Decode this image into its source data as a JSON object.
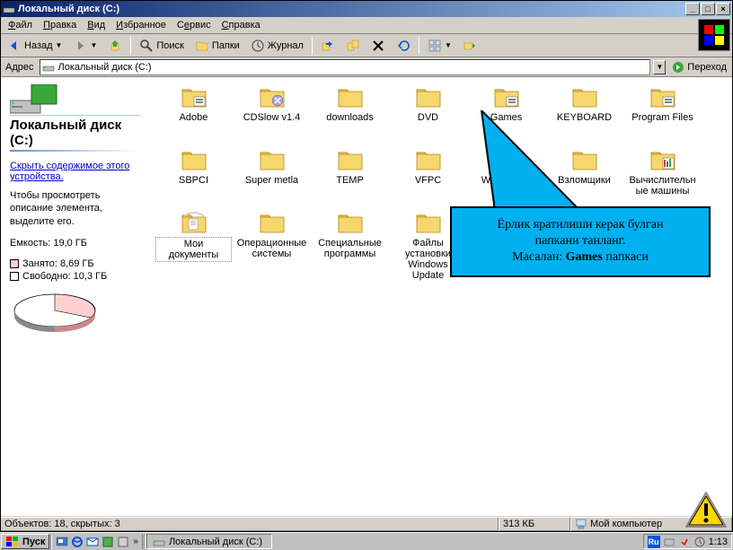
{
  "window": {
    "title": "Локальный диск (C:)",
    "min": "_",
    "max": "□",
    "close": "×"
  },
  "menu": {
    "file": "Файл",
    "edit": "Правка",
    "view": "Вид",
    "favorites": "Избранное",
    "tools": "Сервис",
    "help": "Справка"
  },
  "toolbar": {
    "back": "Назад",
    "search": "Поиск",
    "folders": "Папки",
    "history": "Журнал"
  },
  "address": {
    "label": "Адрес",
    "value": "Локальный диск (C:)",
    "go": "Переход"
  },
  "side": {
    "title": "Локальный диск (C:)",
    "hide_link": "Скрыть содержимое этого устройства.",
    "hint": "Чтобы просмотреть описание элемента, выделите его.",
    "capacity": "Емкость: 19,0 ГБ",
    "used": "Занято: 8,69 ГБ",
    "free": "Свободно: 10,3 ГБ"
  },
  "folders": [
    {
      "name": "Adobe",
      "type": "folder-special"
    },
    {
      "name": "CDSlow v1.4",
      "type": "folder-special2"
    },
    {
      "name": "downloads",
      "type": "folder"
    },
    {
      "name": "DVD",
      "type": "folder"
    },
    {
      "name": "Games",
      "type": "folder-special"
    },
    {
      "name": "KEYBOARD",
      "type": "folder"
    },
    {
      "name": "Program Files",
      "type": "folder-special"
    },
    {
      "name": "SBPCI",
      "type": "folder"
    },
    {
      "name": "Super metla",
      "type": "folder"
    },
    {
      "name": "TEMP",
      "type": "folder"
    },
    {
      "name": "VFPC",
      "type": "folder"
    },
    {
      "name": "WINDOWS",
      "type": "folder-special"
    },
    {
      "name": "Взломщики",
      "type": "folder"
    },
    {
      "name": "Вычислительные машины",
      "type": "folder-special3"
    },
    {
      "name": "Мои документы",
      "type": "folder-docs",
      "selected": true
    },
    {
      "name": "Операционные системы",
      "type": "folder"
    },
    {
      "name": "Специальные программы",
      "type": "folder"
    },
    {
      "name": "Файлы установки Windows Update",
      "type": "folder"
    }
  ],
  "callout": {
    "line1": "Ёрлик яратилиши керак булган",
    "line2": "папкани танланг.",
    "line3_pre": "Масалан: ",
    "line3_bold": "Games",
    "line3_post": " папкаси"
  },
  "status": {
    "objects": "Объектов: 18, скрытых: 3",
    "size": "313 КБ",
    "location": "Мой компьютер"
  },
  "taskbar": {
    "start": "Пуск",
    "task1": "Локальный диск (C:)",
    "lang": "Ru",
    "time": "1:13"
  }
}
